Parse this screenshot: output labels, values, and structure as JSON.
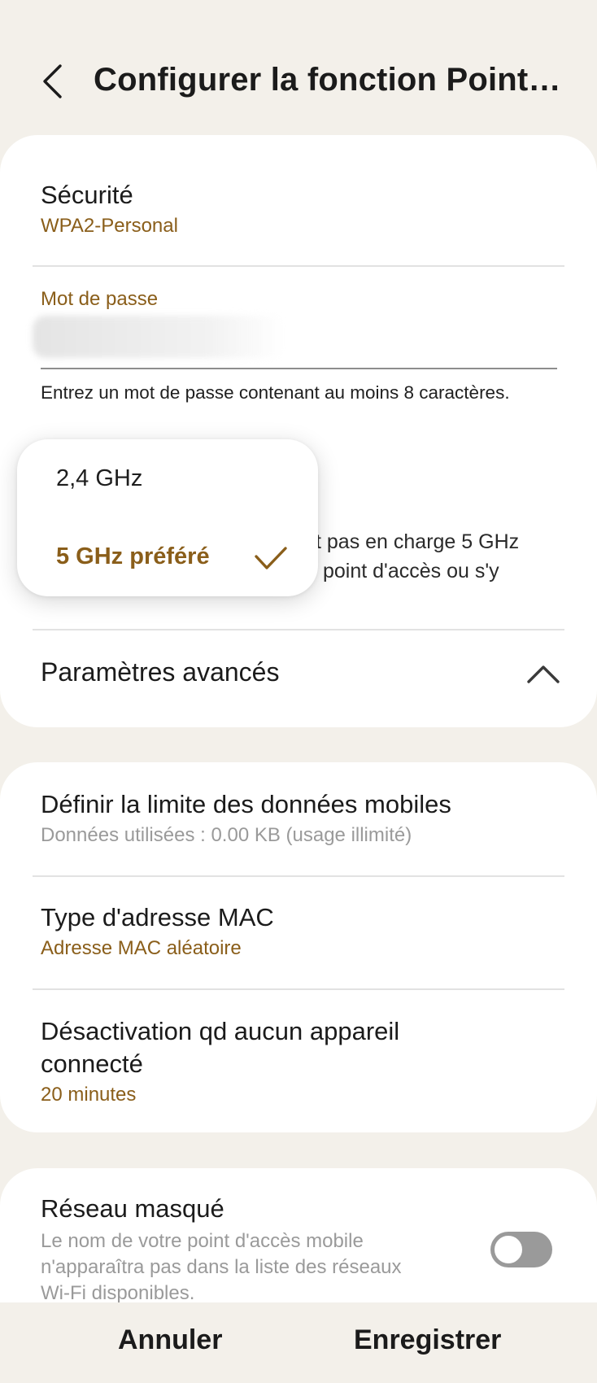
{
  "header": {
    "title": "Configurer la fonction Point…"
  },
  "security": {
    "label": "Sécurité",
    "value": "WPA2-Personal"
  },
  "password": {
    "label": "Mot de passe",
    "hint": "Entrez un mot de passe contenant au moins 8 caractères."
  },
  "band": {
    "description_line1": "t pas en charge 5 GHz",
    "description_line2": "point d'accès ou s'y"
  },
  "band_popup": {
    "options": [
      "2,4 GHz",
      "5 GHz préféré"
    ],
    "selected": "5 GHz préféré"
  },
  "advanced": {
    "label": "Paramètres avancés"
  },
  "data_limit": {
    "label": "Définir la limite des données mobiles",
    "sub": "Données utilisées : 0.00 KB (usage illimité)"
  },
  "mac": {
    "label": "Type d'adresse MAC",
    "value": "Adresse MAC aléatoire"
  },
  "timeout": {
    "label_line1": "Désactivation qd aucun appareil",
    "label_line2": "connecté",
    "value": "20 minutes"
  },
  "hidden_network": {
    "label": "Réseau masqué",
    "desc_line1": "Le nom de votre point d'accès mobile",
    "desc_line2": "n'apparaîtra pas dans la liste des réseaux",
    "desc_line3": "Wi-Fi disponibles.",
    "enabled": false
  },
  "buttons": {
    "cancel": "Annuler",
    "save": "Enregistrer"
  },
  "colors": {
    "accent": "#8a5e1a",
    "background": "#f3f0ea",
    "muted": "#9a9a9a"
  }
}
